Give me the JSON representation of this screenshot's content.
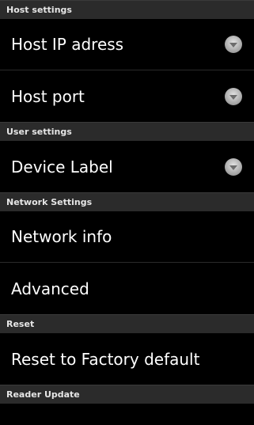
{
  "sections": [
    {
      "header": "Host settings",
      "items": [
        {
          "label": "Host IP adress",
          "icon": "chevron-down-circle-icon"
        },
        {
          "label": "Host port",
          "icon": "chevron-down-circle-icon"
        }
      ]
    },
    {
      "header": "User settings",
      "items": [
        {
          "label": "Device Label",
          "icon": "chevron-down-circle-icon"
        }
      ]
    },
    {
      "header": "Network Settings",
      "items": [
        {
          "label": "Network info"
        },
        {
          "label": "Advanced"
        }
      ]
    },
    {
      "header": "Reset",
      "items": [
        {
          "label": "Reset to Factory default"
        }
      ]
    },
    {
      "header": "Reader Update",
      "items": []
    }
  ],
  "colors": {
    "background": "#000000",
    "header_bg": "#2b2b2b",
    "text": "#ffffff",
    "icon": "#bfbfbf"
  }
}
